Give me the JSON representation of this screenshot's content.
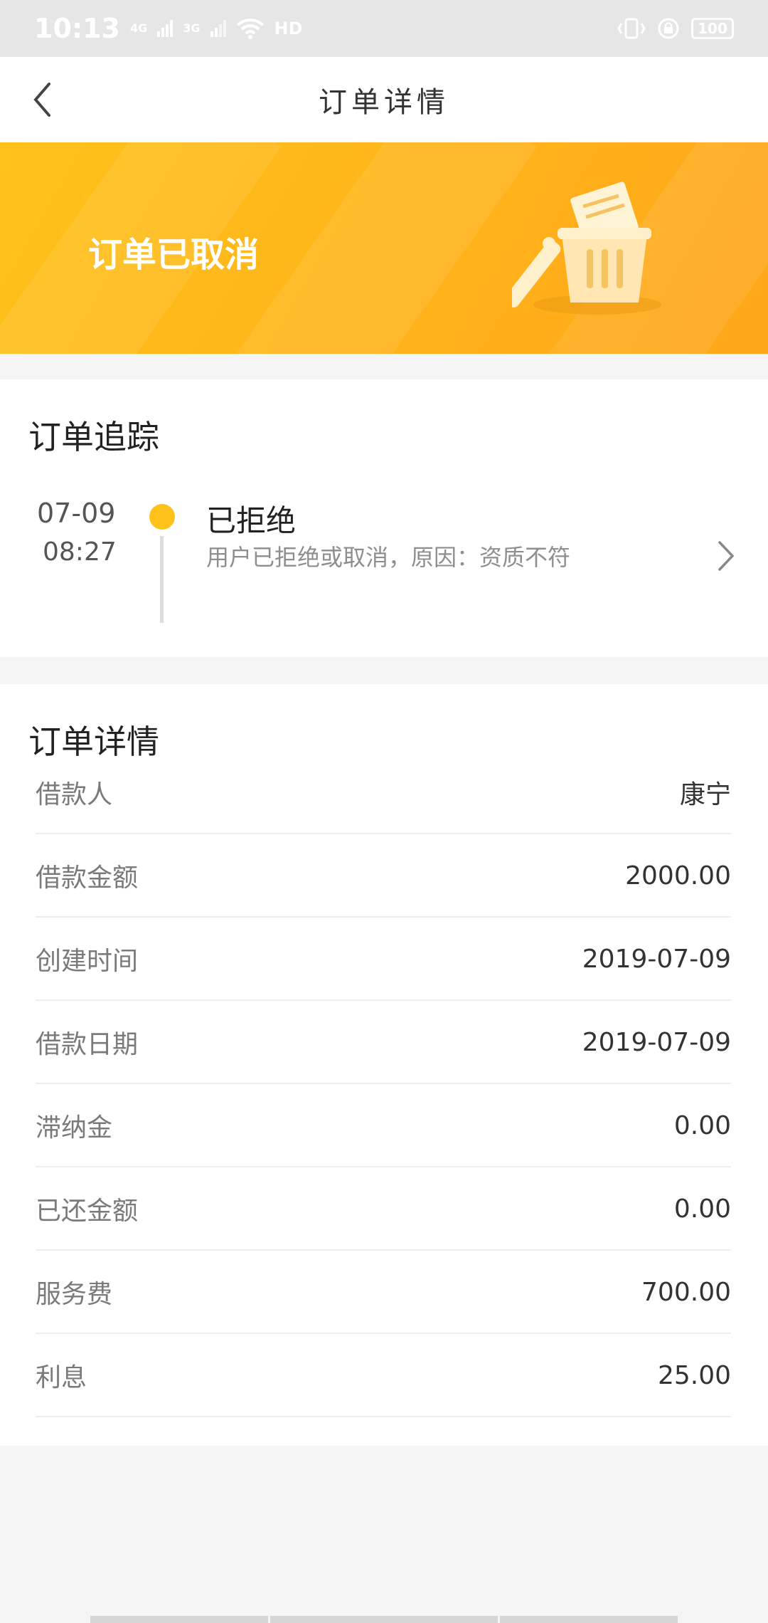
{
  "status_bar": {
    "time": "10:13",
    "network_1": "4G",
    "network_2": "3G",
    "wifi_label": "HD",
    "battery": "100"
  },
  "nav": {
    "title": "订单详情",
    "back_icon": "chevron-left-icon"
  },
  "banner": {
    "status_text": "订单已取消",
    "illustration": "trash-can-icon",
    "background_color": "#ffb61a"
  },
  "tracking": {
    "section_title": "订单追踪",
    "entry": {
      "date": "07-09",
      "time": "08:27",
      "status": "已拒绝",
      "description": "用户已拒绝或取消，原因：资质不符",
      "dot_color": "#ffc21a"
    },
    "chevron_icon": "chevron-right-icon"
  },
  "details": {
    "section_title": "订单详情",
    "rows": [
      {
        "label": "借款人",
        "value": "康宁"
      },
      {
        "label": "借款金额",
        "value": "2000.00"
      },
      {
        "label": "创建时间",
        "value": "2019-07-09"
      },
      {
        "label": "借款日期",
        "value": "2019-07-09"
      },
      {
        "label": "滞纳金",
        "value": "0.00"
      },
      {
        "label": "已还金额",
        "value": "0.00"
      },
      {
        "label": "服务费",
        "value": "700.00"
      },
      {
        "label": "利息",
        "value": "25.00"
      }
    ]
  }
}
